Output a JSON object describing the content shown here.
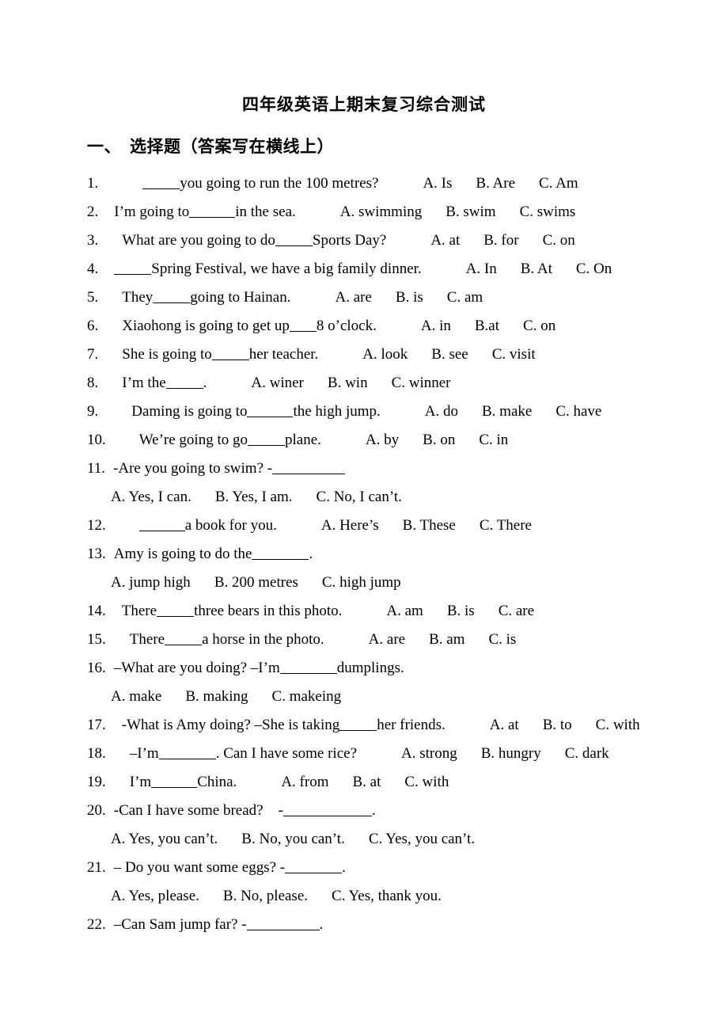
{
  "document": {
    "title": "四年级英语上期末复习综合测试",
    "section_heading_number": "一、",
    "section_heading_text": "选择题（答案写在横线上）",
    "section_heading_full": "一、　选择题（答案写在横线上）"
  },
  "questions": [
    {
      "number": "1.",
      "stem_pre": "",
      "blank": "b-m",
      "stem_post": "you going to run the 100 metres?",
      "options": [
        "A. Is",
        "B. Are",
        "C. Am"
      ],
      "options_inline": true,
      "lead_gap": "gap5"
    },
    {
      "number": "2.",
      "stem_pre": "I’m going to",
      "blank": "b-l",
      "stem_post": "in the sea.",
      "options": [
        "A. swimming",
        "B. swim",
        "C. swims"
      ],
      "options_inline": true,
      "lead_gap": "gap2"
    },
    {
      "number": "3.",
      "stem_pre": "What are you going to do",
      "blank": "b-m",
      "stem_post": "Sports Day?",
      "options": [
        "A. at",
        "B. for",
        "C. on"
      ],
      "options_inline": true,
      "lead_gap": "gap3"
    },
    {
      "number": "4.",
      "stem_pre": "",
      "blank": "b-m",
      "stem_post": "Spring Festival, we have a big family dinner.",
      "options": [
        "A. In",
        "B. At",
        "C. On"
      ],
      "options_inline": true,
      "lead_gap": "gap2"
    },
    {
      "number": "5.",
      "stem_pre": "They",
      "blank": "b-m",
      "stem_post": "going to Hainan.",
      "options": [
        "A. are",
        "B. is",
        "C. am"
      ],
      "options_inline": true,
      "lead_gap": "gap3"
    },
    {
      "number": "6.",
      "stem_pre": "Xiaohong is going to get up",
      "blank": "b-s",
      "stem_post": "8 o’clock.",
      "options": [
        "A. in",
        "B.at",
        "C. on"
      ],
      "options_inline": true,
      "lead_gap": "gap3"
    },
    {
      "number": "7.",
      "stem_pre": "She is going to",
      "blank": "b-m",
      "stem_post": "her teacher.",
      "options": [
        "A. look",
        "B. see",
        "C. visit"
      ],
      "options_inline": true,
      "lead_gap": "gap3"
    },
    {
      "number": "8.",
      "stem_pre": "I’m the",
      "blank": "b-m",
      "stem_post": ".",
      "options": [
        "A. winer",
        "B. win",
        "C. winner"
      ],
      "options_inline": true,
      "lead_gap": "gap3"
    },
    {
      "number": "9.",
      "stem_pre": "Daming is going to",
      "blank": "b-l",
      "stem_post": "the high jump.",
      "options": [
        "A. do",
        "B. make",
        "C. have"
      ],
      "options_inline": true,
      "lead_gap": "gap4"
    },
    {
      "number": "10.",
      "stem_pre": "We’re going to go",
      "blank": "b-m",
      "stem_post": "plane.",
      "options": [
        "A. by",
        "B. on",
        "C. in"
      ],
      "options_inline": true,
      "lead_gap": "gap4"
    },
    {
      "number": "11.",
      "stem_pre": "-Are you going to swim? -",
      "blank": "b-xxl",
      "stem_post": "",
      "options": [
        "A. Yes, I can.",
        "B. Yes, I am.",
        "C. No, I can’t."
      ],
      "options_inline": false,
      "lead_gap": "gap1"
    },
    {
      "number": "12.",
      "stem_pre": "",
      "blank": "b-l",
      "stem_post": "a book for you.",
      "options": [
        "A. Here’s",
        "B. These",
        "C. There"
      ],
      "options_inline": true,
      "lead_gap": "gap4"
    },
    {
      "number": "13.",
      "stem_pre": "Amy is going to do the",
      "blank": "b-xl",
      "stem_post": ".",
      "options": [
        "A. jump high",
        "B. 200 metres",
        "C. high jump"
      ],
      "options_inline": false,
      "lead_gap": "gap1"
    },
    {
      "number": "14.",
      "stem_pre": "There",
      "blank": "b-m",
      "stem_post": "three bears in this photo.",
      "options": [
        "A. am",
        "B. is",
        "C. are"
      ],
      "options_inline": true,
      "lead_gap": "gap2"
    },
    {
      "number": "15.",
      "stem_pre": "There",
      "blank": "b-m",
      "stem_post": "a horse in the photo.",
      "options": [
        "A. are",
        "B. am",
        "C. is"
      ],
      "options_inline": true,
      "lead_gap": "gap3"
    },
    {
      "number": "16.",
      "stem_pre": "–What are you doing? –I’m",
      "blank": "b-xl",
      "stem_post": "dumplings.",
      "options": [
        "A. make",
        "B. making",
        "C. makeing"
      ],
      "options_inline": false,
      "lead_gap": "gap1"
    },
    {
      "number": "17.",
      "stem_pre": "-What is Amy doing? –She is taking",
      "blank": "b-m",
      "stem_post": "her friends.",
      "options": [
        "A. at",
        "B. to",
        "C. with"
      ],
      "options_inline": true,
      "lead_gap": "gap2"
    },
    {
      "number": "18.",
      "stem_pre": "–I’m",
      "blank": "b-xl",
      "stem_post": ". Can I have some rice?",
      "options": [
        "A. strong",
        "B. hungry",
        "C. dark"
      ],
      "options_inline": true,
      "lead_gap": "gap3"
    },
    {
      "number": "19.",
      "stem_pre": "I’m",
      "blank": "b-l",
      "stem_post": "China.",
      "options": [
        "A. from",
        "B. at",
        "C. with"
      ],
      "options_inline": true,
      "lead_gap": "gap3"
    },
    {
      "number": "20.",
      "stem_pre": "-Can I have some bread?    -",
      "blank": "b-huge",
      "stem_post": ".",
      "options": [
        "A. Yes, you can’t.",
        "B. No, you can’t.",
        "C. Yes, you can’t."
      ],
      "options_inline": false,
      "lead_gap": "gap1"
    },
    {
      "number": "21.",
      "stem_pre": "– Do you want some eggs? -",
      "blank": "b-xl",
      "stem_post": ".",
      "options": [
        "A. Yes, please.",
        "B. No, please.",
        "C. Yes, thank you."
      ],
      "options_inline": false,
      "lead_gap": "gap1"
    },
    {
      "number": "22.",
      "stem_pre": "–Can Sam jump far? -",
      "blank": "b-xxl",
      "stem_post": ".",
      "options": [],
      "options_inline": false,
      "lead_gap": "gap1"
    }
  ]
}
